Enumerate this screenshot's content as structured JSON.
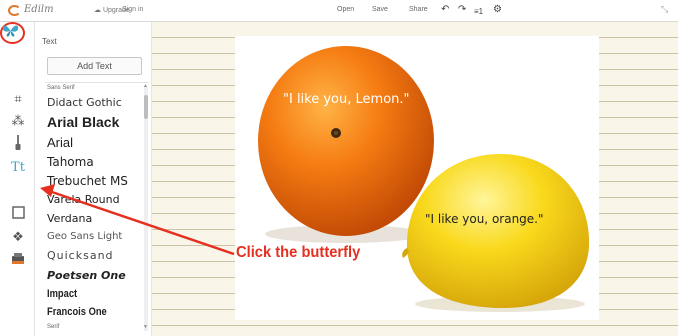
{
  "topbar": {
    "logo_text": "Edilm",
    "upgrade_label": "Upgrade",
    "signin_label": "Sign in",
    "open_label": "Open",
    "save_label": "Save",
    "share_label": "Share",
    "layers_label": "1"
  },
  "panel": {
    "title": "Text",
    "add_text_label": "Add Text",
    "category_top": "Sans Serif",
    "category_bottom": "Serif",
    "fonts": [
      "Didact Gothic",
      "Arial Black",
      "Arial",
      "Tahoma",
      "Trebuchet MS",
      "Varela Round",
      "Verdana",
      "Geo Sans Light",
      "Quicksand",
      "Poetsen One",
      "Impact",
      "Francois One"
    ]
  },
  "canvas": {
    "caption_lemon": "\"I like you, Lemon.\"",
    "caption_orange": "\"I like you, orange.\""
  },
  "annotation": {
    "text": "Click the butterfly"
  },
  "icons": {
    "crop": "crop-icon",
    "wand": "wand-icon",
    "brush": "brush-icon",
    "text": "text-icon",
    "butterfly": "butterfly-icon",
    "frame": "frame-icon",
    "texture": "texture-icon",
    "sticker": "sticker-icon",
    "undo": "undo-icon",
    "redo": "redo-icon",
    "gear": "gear-icon"
  },
  "colors": {
    "accent": "#3ea7c9",
    "annotation": "#e53020",
    "logo": "#e0782c",
    "paper": "#f9f6e9"
  }
}
